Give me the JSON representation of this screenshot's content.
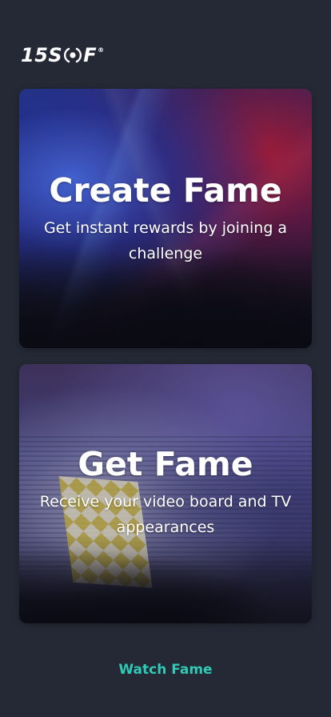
{
  "brand": {
    "logo_text_left": "15S",
    "logo_text_right": "F",
    "logo_registered": "®"
  },
  "cards": [
    {
      "title": "Create Fame",
      "subtitle": "Get instant rewards by joining a challenge"
    },
    {
      "title": "Get Fame",
      "subtitle": "Receive your video board and TV appearances"
    }
  ],
  "footer": {
    "watch_label": "Watch Fame"
  },
  "colors": {
    "background": "#242935",
    "accent": "#2fc9b4",
    "text": "#ffffff"
  }
}
